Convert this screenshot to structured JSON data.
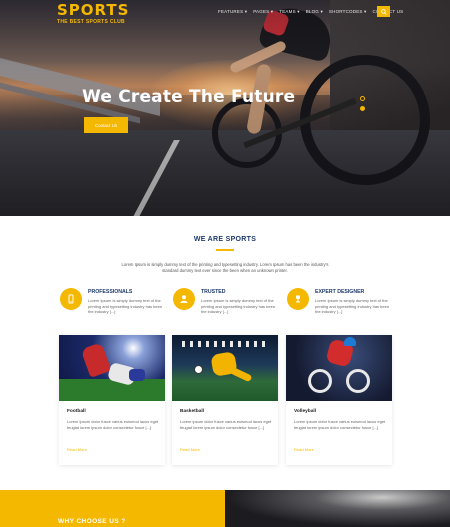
{
  "brand": {
    "logo_text": "SPORTS",
    "tagline": "THE BEST SPORTS CLUB",
    "accent_color": "#f5b800",
    "heading_color": "#1f3a6b"
  },
  "nav": {
    "items": [
      "FEATURES ▾",
      "PAGES ▾",
      "TEAMS ▾",
      "BLOG ▾",
      "SHORTCODES ▾",
      "CONTACT US"
    ],
    "search_icon": "search-icon"
  },
  "hero": {
    "title": "We Create The Future",
    "button_label": "Contact Us",
    "slides_total": 2,
    "slide_active": 1
  },
  "about": {
    "heading": "WE ARE SPORTS",
    "text": "Lorem Ipsum is simply dummy text of the printing and typesetting industry. Lorem Ipsum has been the industry's standard dummy text ever since the been when an unknown printer.",
    "features": [
      {
        "title": "PROFESSIONALS",
        "text": "Lorem Ipsum is simply dummy text of the printing and typesetting industry has been the industry [...]",
        "icon": "phone-icon"
      },
      {
        "title": "TRUSTED",
        "text": "Lorem Ipsum is simply dummy text of the printing and typesetting industry has been the industry [...]",
        "icon": "user-icon"
      },
      {
        "title": "EXPERT DESIGNER",
        "text": "Lorem Ipsum is simply dummy text of the printing and typesetting industry has been the industry [...]",
        "icon": "trophy-icon"
      }
    ]
  },
  "cards": [
    {
      "title": "Football",
      "text": "Lorem ipsum dolor fusce varius euismod lacus eget feugiat lorem ipsum dolor consectetur fusce [...]",
      "link": "Read More"
    },
    {
      "title": "Basketball",
      "text": "Lorem ipsum dolor fusce varius euismod lacus eget feugiat lorem ipsum dolor consectetur fusce [...]",
      "link": "Read More"
    },
    {
      "title": "Volleyball",
      "text": "Lorem ipsum dolor fusce varius euismod lacus eget feugiat lorem ipsum dolor consectetur fusce [...]",
      "link": "Read More"
    }
  ],
  "bottom": {
    "heading": "WHY CHOOSE US ?"
  }
}
